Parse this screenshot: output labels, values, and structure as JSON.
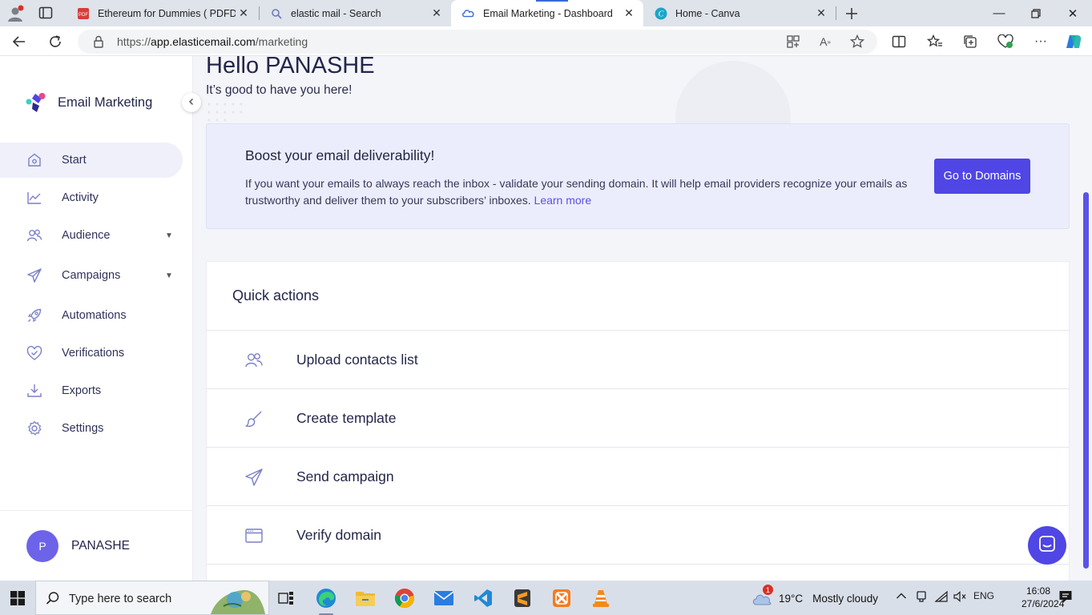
{
  "browser": {
    "tabs": [
      {
        "title": "Ethereum for Dummies ( PDFDriv",
        "favicon": "pdf-icon",
        "active": false
      },
      {
        "title": "elastic mail - Search",
        "favicon": "search-icon",
        "active": false
      },
      {
        "title": "Email Marketing - Dashboard",
        "favicon": "elastic-email-icon",
        "active": true
      },
      {
        "title": "Home - Canva",
        "favicon": "canva-icon",
        "active": false
      }
    ],
    "url_prefix": "https://",
    "url_host": "app.elasticemail.com",
    "url_path": "/marketing"
  },
  "sidebar": {
    "brand": "Email Marketing",
    "items": [
      {
        "label": "Start",
        "icon": "home-icon",
        "active": true
      },
      {
        "label": "Activity",
        "icon": "activity-chart-icon"
      },
      {
        "label": "Audience",
        "icon": "users-icon",
        "expandable": true
      },
      {
        "label": "Campaigns",
        "icon": "send-icon",
        "expandable": true
      },
      {
        "label": "Automations",
        "icon": "rocket-icon"
      },
      {
        "label": "Verifications",
        "icon": "heart-check-icon"
      },
      {
        "label": "Exports",
        "icon": "download-icon"
      },
      {
        "label": "Settings",
        "icon": "gear-icon"
      }
    ],
    "user": {
      "initial": "P",
      "name": "PANASHE"
    }
  },
  "main": {
    "greeting": "Hello PANASHE",
    "subgreeting": "It’s good to have you here!",
    "banner": {
      "title": "Boost your email deliverability!",
      "text": "If you want your emails to always reach the inbox - validate your sending domain. It will help email providers recognize your emails as trustworthy and deliver them to your subscribers’ inboxes.",
      "link": "Learn more",
      "button": "Go to Domains"
    },
    "quick_actions": {
      "title": "Quick actions",
      "items": [
        {
          "label": "Upload contacts list",
          "icon": "users-icon"
        },
        {
          "label": "Create template",
          "icon": "brush-icon"
        },
        {
          "label": "Send campaign",
          "icon": "send-icon"
        },
        {
          "label": "Verify domain",
          "icon": "browser-window-icon"
        }
      ]
    }
  },
  "taskbar": {
    "search_placeholder": "Type here to search",
    "weather": {
      "temp": "19°C",
      "condition": "Mostly cloudy",
      "badge": "1"
    },
    "language": "ENG",
    "time": "16:08",
    "date": "27/6/2024"
  },
  "colors": {
    "accent": "#4f46e5",
    "brand_pink": "#e8488a",
    "brand_teal": "#3ccfbf"
  }
}
